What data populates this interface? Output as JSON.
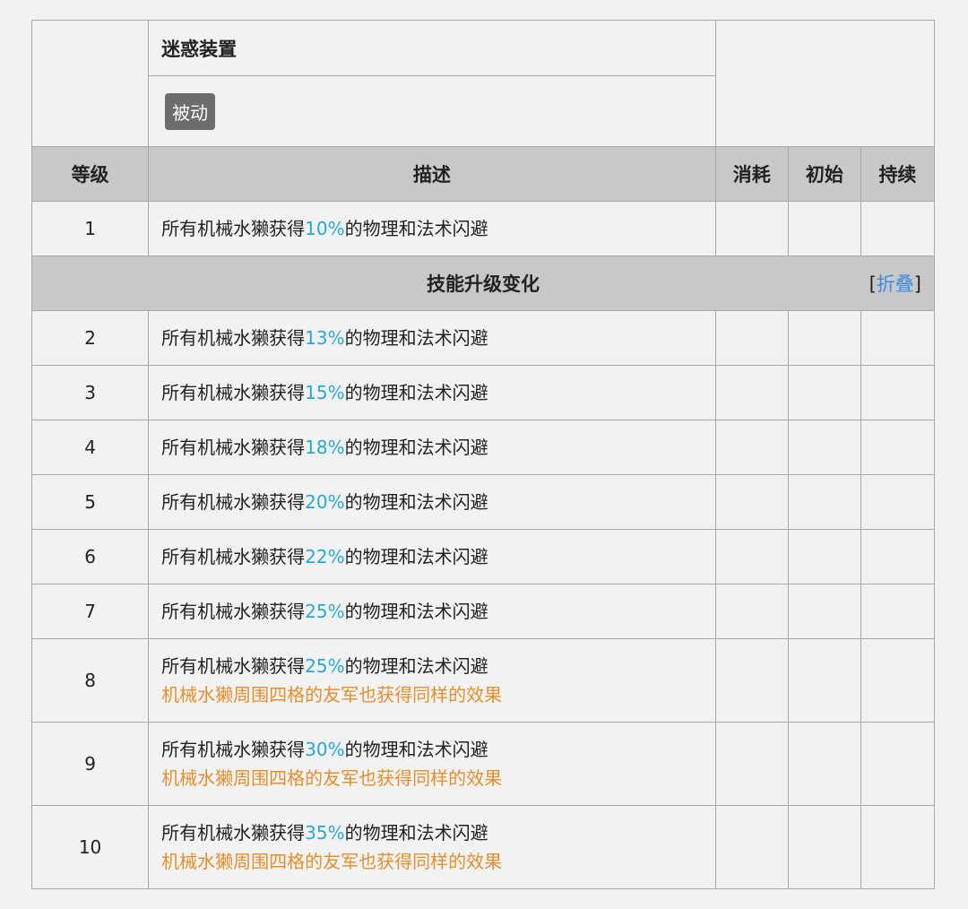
{
  "skill": {
    "name": "迷惑装置",
    "type": "被动"
  },
  "headers": {
    "level": "等级",
    "description": "描述",
    "cost": "消耗",
    "initial": "初始",
    "duration": "持续"
  },
  "base_row": {
    "level": "1",
    "prefix": "所有机械水獭获得",
    "value": "10%",
    "suffix": "的物理和法术闪避"
  },
  "upgrade_banner": {
    "title": "技能升级变化",
    "fold_open": "[",
    "fold_label": "折叠",
    "fold_close": "]"
  },
  "rows": [
    {
      "level": "2",
      "prefix": "所有机械水獭获得",
      "value": "13%",
      "suffix": "的物理和法术闪避",
      "extra": ""
    },
    {
      "level": "3",
      "prefix": "所有机械水獭获得",
      "value": "15%",
      "suffix": "的物理和法术闪避",
      "extra": ""
    },
    {
      "level": "4",
      "prefix": "所有机械水獭获得",
      "value": "18%",
      "suffix": "的物理和法术闪避",
      "extra": ""
    },
    {
      "level": "5",
      "prefix": "所有机械水獭获得",
      "value": "20%",
      "suffix": "的物理和法术闪避",
      "extra": ""
    },
    {
      "level": "6",
      "prefix": "所有机械水獭获得",
      "value": "22%",
      "suffix": "的物理和法术闪避",
      "extra": ""
    },
    {
      "level": "7",
      "prefix": "所有机械水獭获得",
      "value": "25%",
      "suffix": "的物理和法术闪避",
      "extra": ""
    },
    {
      "level": "8",
      "prefix": "所有机械水獭获得",
      "value": "25%",
      "suffix": "的物理和法术闪避",
      "extra": "机械水獭周围四格的友军也获得同样的效果"
    },
    {
      "level": "9",
      "prefix": "所有机械水獭获得",
      "value": "30%",
      "suffix": "的物理和法术闪避",
      "extra": "机械水獭周围四格的友军也获得同样的效果"
    },
    {
      "level": "10",
      "prefix": "所有机械水獭获得",
      "value": "35%",
      "suffix": "的物理和法术闪避",
      "extra": "机械水獭周围四格的友军也获得同样的效果"
    }
  ],
  "colors": {
    "highlight": "#29a8d8",
    "extra": "#e58e2e",
    "link": "#3a8ce0",
    "header_bg": "#c8c8c8"
  }
}
